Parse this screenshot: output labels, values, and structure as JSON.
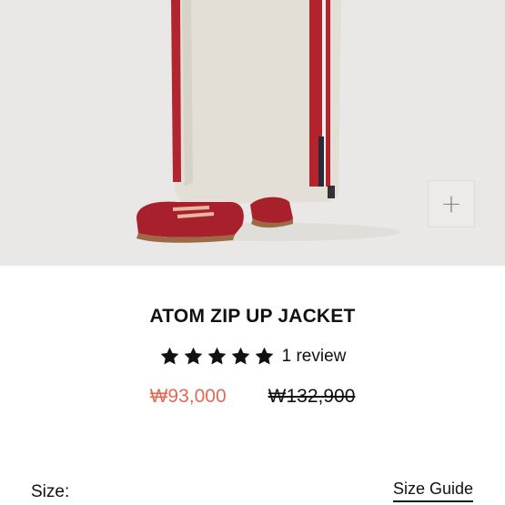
{
  "product": {
    "title": "ATOM ZIP UP JACKET",
    "rating": 5,
    "review_text": "1 review",
    "sale_price": "₩93,000",
    "original_price": "₩132,900"
  },
  "gallery": {
    "zoom_icon": "plus-icon"
  },
  "options": {
    "size_label": "Size:",
    "size_guide_label": "Size Guide"
  },
  "colors": {
    "sale": "#e06a56",
    "hero_bg": "#e9e8e6",
    "accent_red": "#b3252e"
  }
}
